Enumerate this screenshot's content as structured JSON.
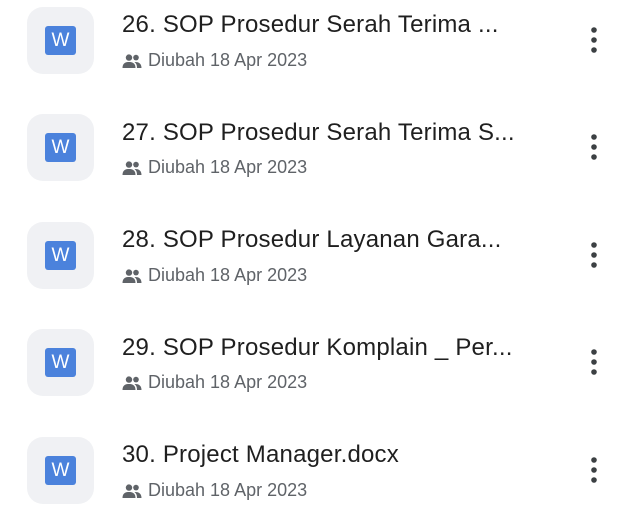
{
  "files": [
    {
      "title": "26. SOP Prosedur Serah Terima ...",
      "modified": "Diubah 18 Apr 2023",
      "type_icon": "W"
    },
    {
      "title": "27. SOP Prosedur Serah Terima S...",
      "modified": "Diubah 18 Apr 2023",
      "type_icon": "W"
    },
    {
      "title": "28. SOP Prosedur Layanan Gara...",
      "modified": "Diubah 18 Apr 2023",
      "type_icon": "W"
    },
    {
      "title": "29. SOP Prosedur Komplain _ Per...",
      "modified": "Diubah 18 Apr 2023",
      "type_icon": "W"
    },
    {
      "title": "30. Project Manager.docx",
      "modified": "Diubah 18 Apr 2023",
      "type_icon": "W"
    }
  ],
  "icons": {
    "file_type": "word-doc-icon",
    "shared": "people-icon",
    "more": "more-vert-icon"
  },
  "colors": {
    "word_blue": "#4b82dc",
    "thumb_bg": "#f0f1f4",
    "title_text": "#1f1f1f",
    "meta_text": "#5f6368"
  }
}
